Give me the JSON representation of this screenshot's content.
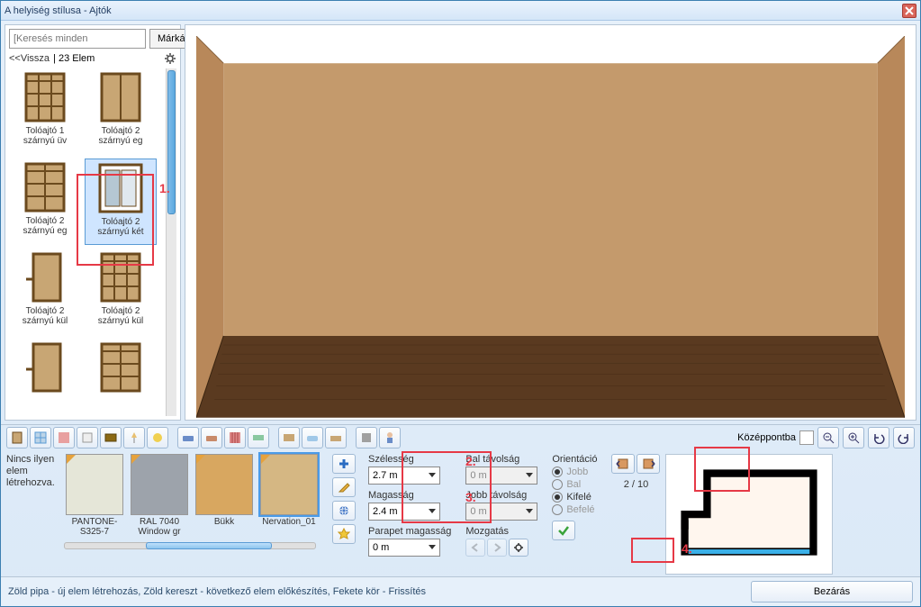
{
  "title": "A helyiség stílusa - Ajtók",
  "search": {
    "placeholder": "[Keresés minden"
  },
  "brands_btn": "Márkák",
  "back_link": "<<Vissza",
  "item_count": "| 23 Elem",
  "catalog": [
    {
      "label": "Tolóajtó 1 szárnyú üv"
    },
    {
      "label": "Tolóajtó 2 szárnyú eg"
    },
    {
      "label": "Tolóajtó 2 szárnyú eg"
    },
    {
      "label": "Tolóajtó 2 szárnyú két"
    },
    {
      "label": "Tolóajtó 2 szárnyú kül"
    },
    {
      "label": "Tolóajtó 2 szárnyú kül"
    },
    {
      "label": ""
    },
    {
      "label": ""
    }
  ],
  "nolabel": "Nincs ilyen elem létrehozva.",
  "swatches": [
    {
      "label": "PANTONE-S325-7",
      "color": "#e5e6d8"
    },
    {
      "label": "RAL 7040 Window gr",
      "color": "#9da3ab"
    },
    {
      "label": "Bükk",
      "color": "#d8a760"
    },
    {
      "label": "Nervation_01",
      "color": "#d5b783"
    }
  ],
  "center_label": "Középpontba",
  "props": {
    "width_label": "Szélesség",
    "width_value": "2.7 m",
    "height_label": "Magasság",
    "height_value": "2.4 m",
    "parapet_label": "Parapet magasság",
    "parapet_value": "0 m",
    "left_dist_label": "Bal távolság",
    "left_dist_value": "0 m",
    "right_dist_label": "Jobb távolság",
    "right_dist_value": "0 m",
    "move_label": "Mozgatás",
    "orient_label": "Orientáció",
    "orient_jobb": "Jobb",
    "orient_bal": "Bal",
    "orient_kifele": "Kifelé",
    "orient_befele": "Befelé"
  },
  "page_indicator": "2 / 10",
  "status": "Zöld pipa - új elem létrehozás, Zöld kereszt - következő elem előkészítés, Fekete kör - Frissítés",
  "close_label": "Bezárás",
  "annotations": {
    "a1": "1.",
    "a2": "2.",
    "a3": "3.",
    "a4": "4."
  }
}
